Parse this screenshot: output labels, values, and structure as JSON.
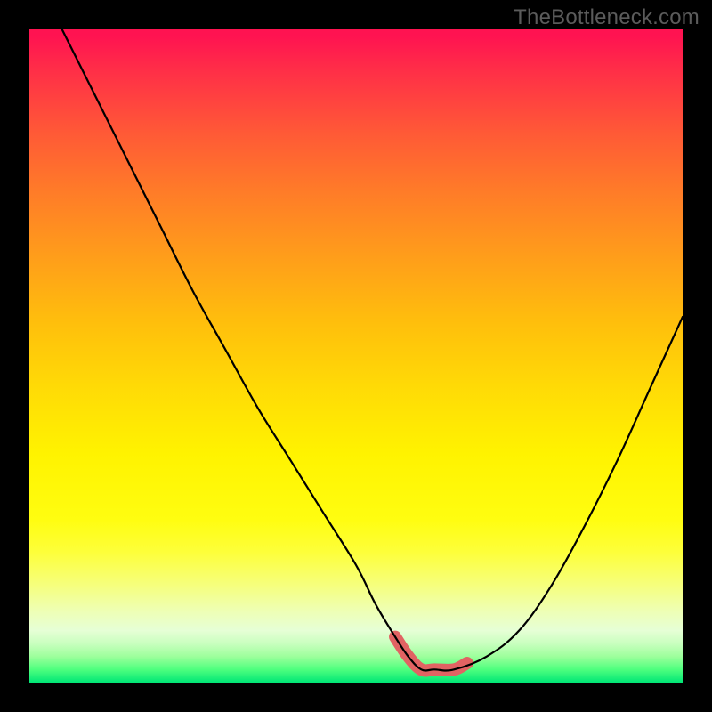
{
  "watermark": "TheBottleneck.com",
  "colors": {
    "curve": "#000000",
    "highlight": "#e16363",
    "frame": "#000000"
  },
  "chart_data": {
    "type": "line",
    "title": "",
    "xlabel": "",
    "ylabel": "",
    "xlim": [
      0,
      100
    ],
    "ylim": [
      0,
      100
    ],
    "grid": false,
    "annotations": [
      "TheBottleneck.com"
    ],
    "series": [
      {
        "name": "bottleneck-curve",
        "x": [
          5,
          10,
          15,
          20,
          25,
          30,
          35,
          40,
          45,
          50,
          53,
          56,
          58,
          60,
          62,
          65,
          70,
          75,
          80,
          85,
          90,
          95,
          100
        ],
        "y": [
          100,
          90,
          80,
          70,
          60,
          51,
          42,
          34,
          26,
          18,
          12,
          7,
          4,
          2,
          2,
          2,
          4,
          8,
          15,
          24,
          34,
          45,
          56
        ]
      },
      {
        "name": "optimal-range-highlight",
        "x": [
          56,
          58,
          60,
          62,
          65,
          67
        ],
        "y": [
          7,
          4,
          2,
          2,
          2,
          3
        ]
      }
    ]
  }
}
